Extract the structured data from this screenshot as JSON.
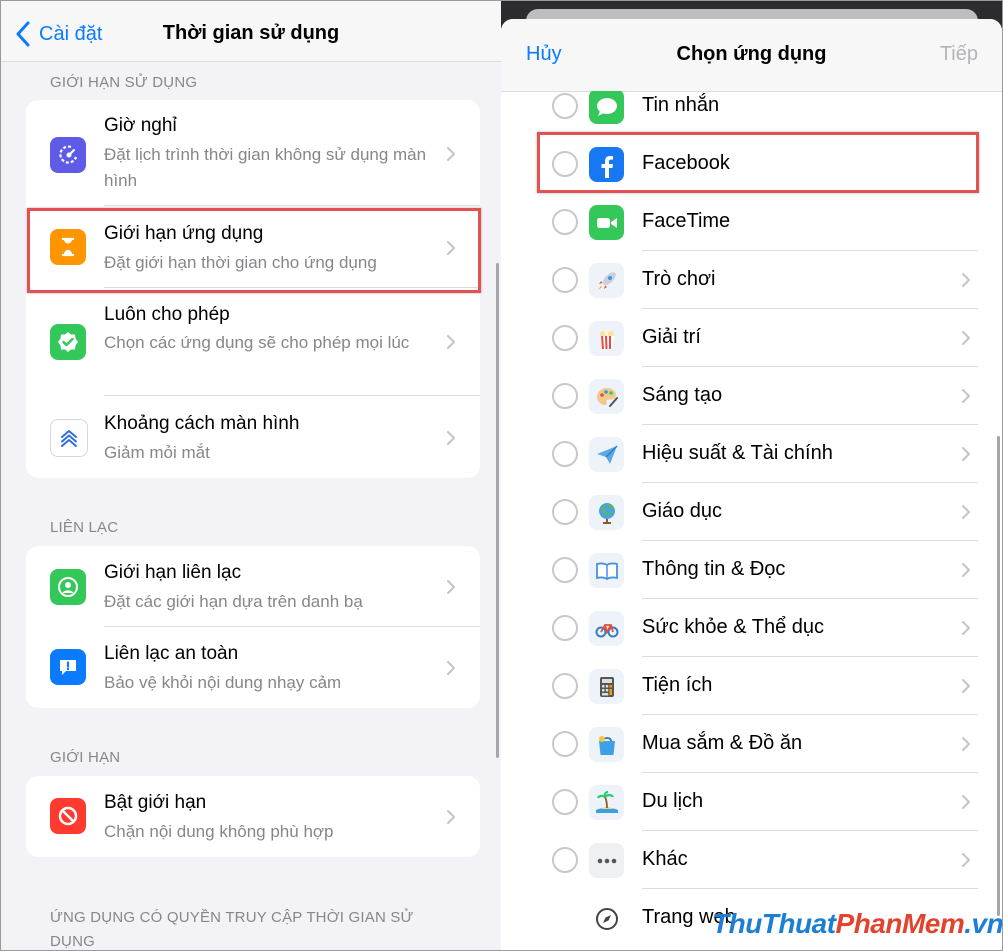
{
  "left": {
    "back_label": "Cài đặt",
    "title": "Thời gian sử dụng",
    "sections": [
      {
        "header": "GIỚI HẠN SỬ DỤNG",
        "rows": [
          {
            "title": "Giờ nghỉ",
            "subtitle": "Đặt lịch trình thời gian không sử dụng màn hình",
            "icon": "downtime-icon",
            "color": "#5e5ce6"
          },
          {
            "title": "Giới hạn ứng dụng",
            "subtitle": "Đặt giới hạn thời gian cho ứng dụng",
            "icon": "hourglass-icon",
            "color": "#ff9500"
          },
          {
            "title": "Luôn cho phép",
            "subtitle": "Chọn các ứng dụng sẽ cho phép mọi lúc",
            "icon": "checkmark-badge-icon",
            "color": "#34c759"
          },
          {
            "title": "Khoảng cách màn hình",
            "subtitle": "Giảm mỏi mắt",
            "icon": "screen-distance-icon",
            "color": "#ffffff"
          }
        ]
      },
      {
        "header": "LIÊN LẠC",
        "rows": [
          {
            "title": "Giới hạn liên lạc",
            "subtitle": "Đặt các giới hạn dựa trên danh bạ",
            "icon": "person-circle-icon",
            "color": "#34c759"
          },
          {
            "title": "Liên lạc an toàn",
            "subtitle": "Bảo vệ khỏi nội dung nhạy cảm",
            "icon": "message-alert-icon",
            "color": "#0a7aff"
          }
        ]
      },
      {
        "header": "GIỚI HẠN",
        "rows": [
          {
            "title": "Bật giới hạn",
            "subtitle": "Chặn nội dung không phù hợp",
            "icon": "restricted-icon",
            "color": "#ff3b30"
          }
        ]
      },
      {
        "header": "ỨNG DỤNG CÓ QUYỀN TRUY CẬP THỜI GIAN SỬ DỤNG",
        "rows": []
      }
    ]
  },
  "right": {
    "cancel_label": "Hủy",
    "title": "Chọn ứng dụng",
    "next_label": "Tiếp",
    "apps": [
      {
        "label": "Tin nhắn",
        "icon": "messages-icon"
      },
      {
        "label": "Facebook",
        "icon": "facebook-icon"
      },
      {
        "label": "FaceTime",
        "icon": "facetime-icon"
      },
      {
        "label": "Trò chơi",
        "icon": "rocket-icon"
      },
      {
        "label": "Giải trí",
        "icon": "popcorn-icon"
      },
      {
        "label": "Sáng tạo",
        "icon": "palette-icon"
      },
      {
        "label": "Hiệu suất & Tài chính",
        "icon": "paper-plane-icon"
      },
      {
        "label": "Giáo dục",
        "icon": "globe-icon"
      },
      {
        "label": "Thông tin & Đọc",
        "icon": "book-icon"
      },
      {
        "label": "Sức khỏe & Thể dục",
        "icon": "bicycle-icon"
      },
      {
        "label": "Tiện ích",
        "icon": "calculator-icon"
      },
      {
        "label": "Mua sắm & Đồ ăn",
        "icon": "shopping-bag-icon"
      },
      {
        "label": "Du lịch",
        "icon": "island-icon"
      },
      {
        "label": "Khác",
        "icon": "more-icon"
      },
      {
        "label": "Trang web",
        "icon": "compass-icon"
      }
    ]
  },
  "watermark": {
    "part1": "ThuThuat",
    "part2": "PhanMem",
    "part3": ".vn"
  },
  "colors": {
    "accent": "#0a7aff",
    "highlight": "#e35253",
    "secondary_text": "#86868b"
  }
}
